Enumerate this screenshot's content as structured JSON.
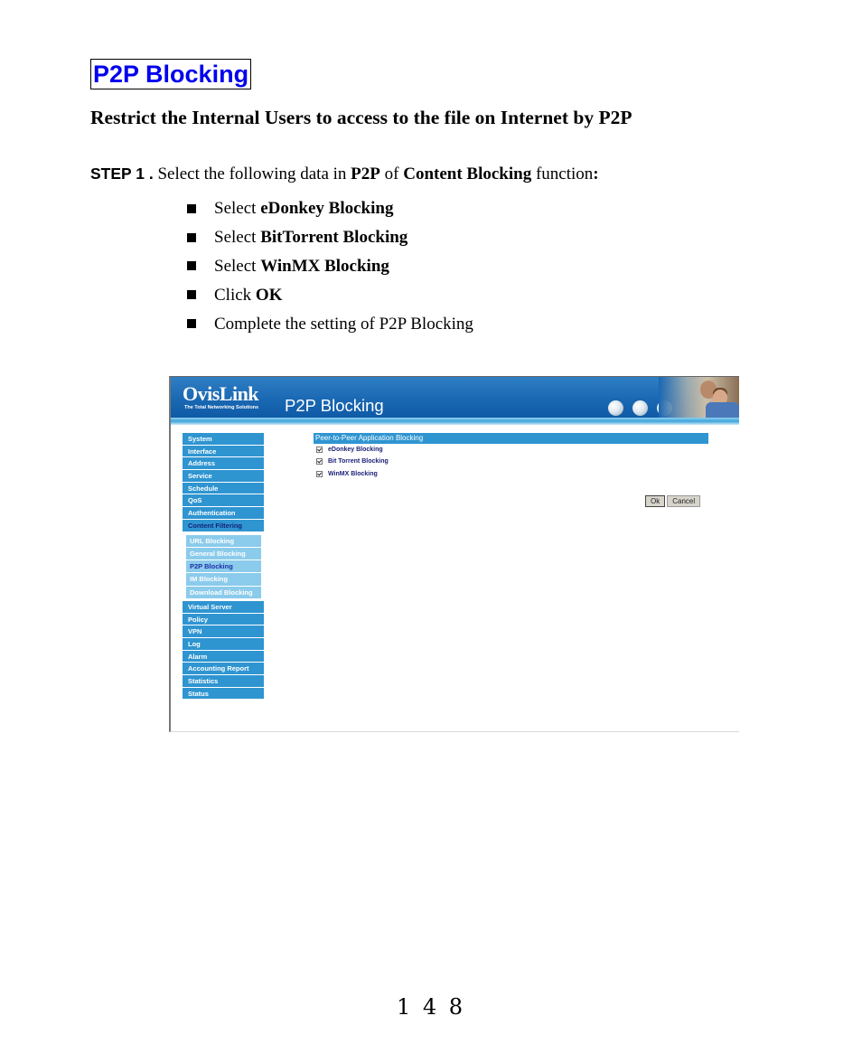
{
  "section_title": "P2P Blocking",
  "subtitle": "Restrict the Internal Users to access to the file on Internet by P2P",
  "step": {
    "label": "STEP 1 .",
    "text_1": " Select the following data in ",
    "bold_1": "P2P",
    "text_2": " of ",
    "bold_2": "Content Blocking",
    "text_3": " function",
    "bold_3": ":"
  },
  "bullets": [
    {
      "prefix": "Select ",
      "bold": "eDonkey Blocking"
    },
    {
      "prefix": "Select ",
      "bold": "BitTorrent Blocking"
    },
    {
      "prefix": "Select ",
      "bold": "WinMX Blocking"
    },
    {
      "prefix": "Click ",
      "bold": "OK"
    },
    {
      "prefix": "Complete the setting of P2P Blocking",
      "bold": ""
    }
  ],
  "screenshot": {
    "logo": "OvisLink",
    "logo_tagline": "The Total Networking Solutions",
    "page_heading": "P2P Blocking",
    "nav": {
      "items_top": [
        {
          "label": "System"
        },
        {
          "label": "Interface"
        },
        {
          "label": "Address"
        },
        {
          "label": "Service"
        },
        {
          "label": "Schedule"
        },
        {
          "label": "QoS"
        },
        {
          "label": "Authentication"
        },
        {
          "label": "Content Filtering",
          "active": true
        }
      ],
      "sub_items": [
        {
          "label": "URL Blocking"
        },
        {
          "label": "General Blocking"
        },
        {
          "label": "P2P Blocking",
          "active": true
        },
        {
          "label": "IM Blocking"
        },
        {
          "label": "Download Blocking"
        }
      ],
      "items_bottom": [
        {
          "label": "Virtual Server"
        },
        {
          "label": "Policy"
        },
        {
          "label": "VPN"
        },
        {
          "label": "Log"
        },
        {
          "label": "Alarm"
        },
        {
          "label": "Accounting Report"
        },
        {
          "label": "Statistics"
        },
        {
          "label": "Status"
        }
      ]
    },
    "content": {
      "header": "Peer-to-Peer Application Blocking",
      "options": [
        {
          "label": "eDonkey Blocking",
          "checked": true
        },
        {
          "label": "Bit Torrent Blocking",
          "checked": true
        },
        {
          "label": "WinMX Blocking",
          "checked": true
        }
      ],
      "ok_label": "Ok",
      "cancel_label": "Cancel"
    },
    "colors": {
      "nav_item": "#2f95d1",
      "nav_sub_item": "#8bcbeb",
      "banner": "#1a68b3",
      "active_text": "#14237a"
    }
  },
  "page_number": "148",
  "colors": {
    "section_title": "#0000ee"
  }
}
